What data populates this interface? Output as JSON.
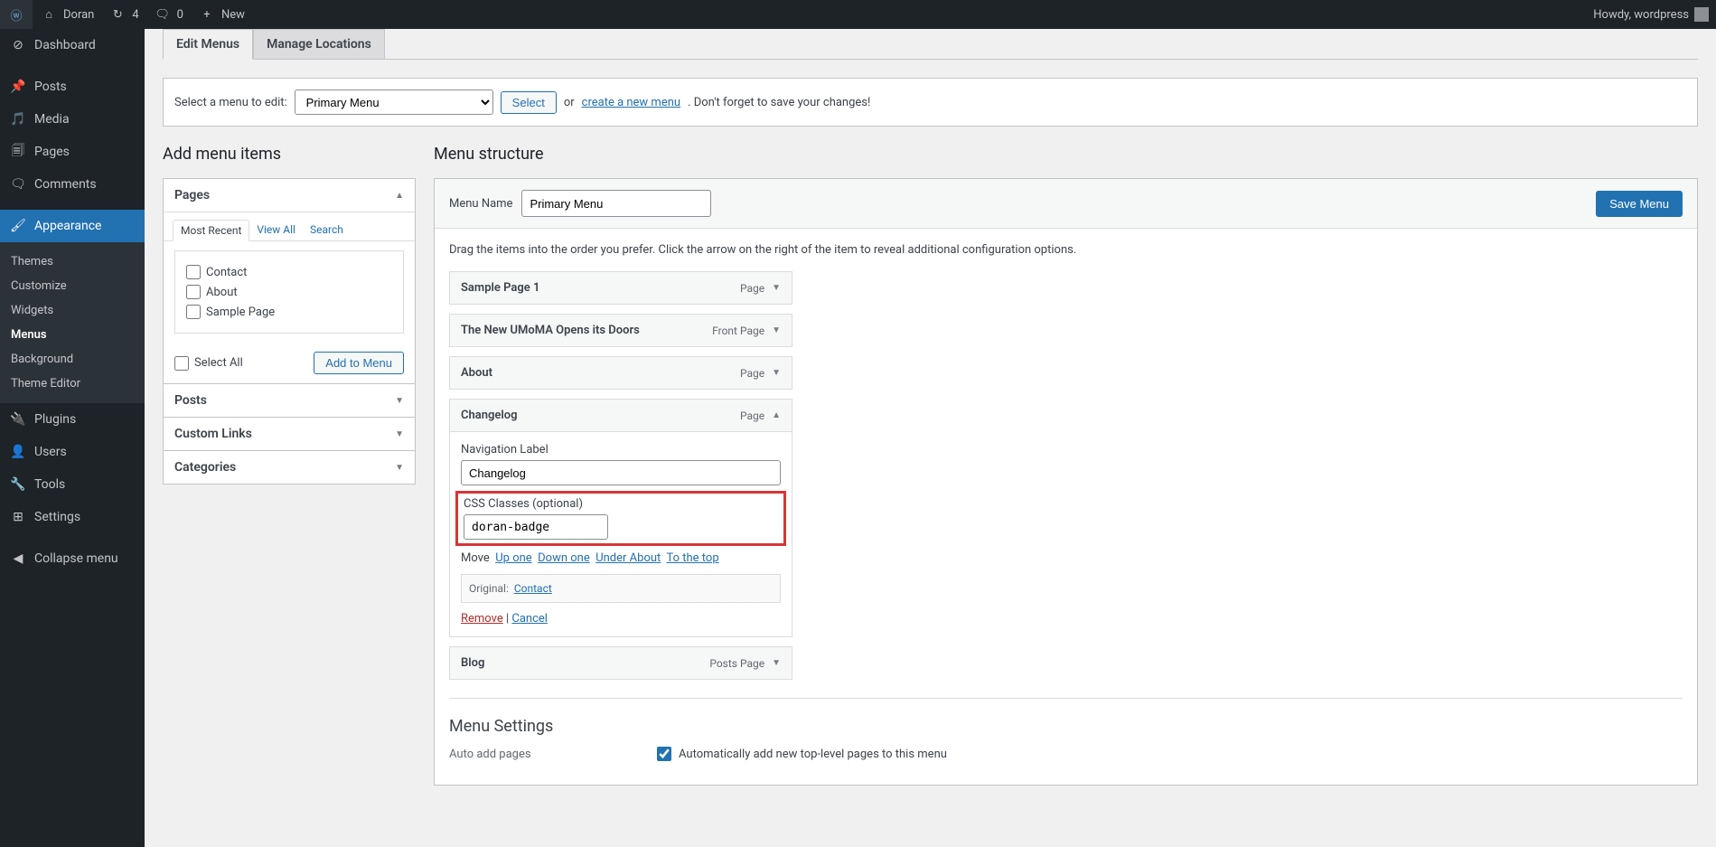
{
  "adminbar": {
    "site_name": "Doran",
    "updates_count": "4",
    "comments_count": "0",
    "new_label": "New",
    "howdy": "Howdy, wordpress"
  },
  "sidebar": {
    "dashboard": "Dashboard",
    "posts": "Posts",
    "media": "Media",
    "pages": "Pages",
    "comments": "Comments",
    "appearance": "Appearance",
    "themes": "Themes",
    "customize": "Customize",
    "widgets": "Widgets",
    "menus": "Menus",
    "background": "Background",
    "theme_editor": "Theme Editor",
    "plugins": "Plugins",
    "users": "Users",
    "tools": "Tools",
    "settings": "Settings",
    "collapse": "Collapse menu"
  },
  "tabs": {
    "edit_menus": "Edit Menus",
    "manage_locations": "Manage Locations"
  },
  "select_row": {
    "label": "Select a menu to edit:",
    "selected": "Primary Menu",
    "select_btn": "Select",
    "or": "or",
    "create_link": "create a new menu",
    "save_hint": ". Don't forget to save your changes!"
  },
  "left": {
    "heading": "Add menu items",
    "pages": {
      "title": "Pages",
      "tab_recent": "Most Recent",
      "tab_viewall": "View All",
      "tab_search": "Search",
      "items": [
        "Contact",
        "About",
        "Sample Page"
      ],
      "select_all": "Select All",
      "add_btn": "Add to Menu"
    },
    "posts": "Posts",
    "custom_links": "Custom Links",
    "categories": "Categories"
  },
  "right": {
    "heading": "Menu structure",
    "menu_name_label": "Menu Name",
    "menu_name_value": "Primary Menu",
    "save_btn": "Save Menu",
    "drag_notice": "Drag the items into the order you prefer. Click the arrow on the right of the item to reveal additional configuration options.",
    "items": [
      {
        "title": "Sample Page 1",
        "type": "Page"
      },
      {
        "title": "The New UMoMA Opens its Doors",
        "type": "Front Page"
      },
      {
        "title": "About",
        "type": "Page"
      }
    ],
    "expanded": {
      "title": "Changelog",
      "type": "Page",
      "nav_label_label": "Navigation Label",
      "nav_label_value": "Changelog",
      "css_label": "CSS Classes (optional)",
      "css_value": "doran-badge",
      "move_label": "Move",
      "up_one": "Up one",
      "down_one": "Down one",
      "under_about": "Under About",
      "to_top": "To the top",
      "original_label": "Original:",
      "original_link": "Contact",
      "remove": "Remove",
      "cancel": "Cancel"
    },
    "after_items": [
      {
        "title": "Blog",
        "type": "Posts Page"
      }
    ],
    "settings": {
      "heading": "Menu Settings",
      "auto_add_label": "Auto add pages",
      "auto_add_text": "Automatically add new top-level pages to this menu"
    }
  }
}
